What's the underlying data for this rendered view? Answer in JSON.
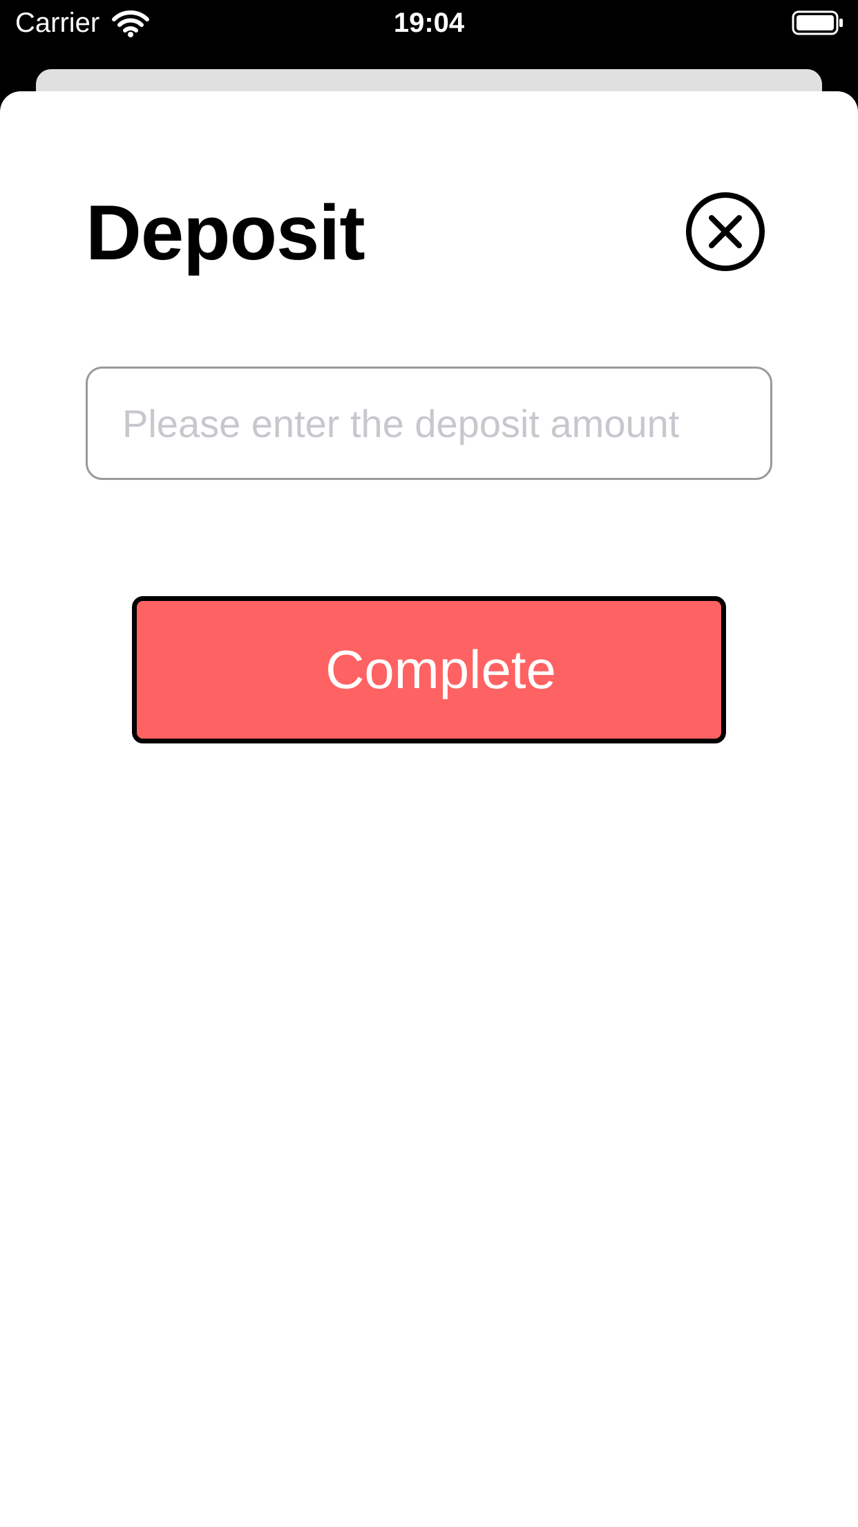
{
  "status_bar": {
    "carrier": "Carrier",
    "time": "19:04",
    "wifi_icon": "wifi-icon",
    "battery_icon": "battery-full-icon"
  },
  "sheet": {
    "title": "Deposit",
    "close_icon": "close-circle-icon",
    "amount_input": {
      "value": "",
      "placeholder": "Please enter the deposit amount"
    },
    "complete_button": {
      "label": "Complete"
    }
  },
  "colors": {
    "status_bar_background": "#000000",
    "sheet_background": "#ffffff",
    "back_card": "#e0e0e0",
    "button_fill": "#ff6262",
    "button_border": "#000000",
    "button_text": "#ffffff",
    "placeholder_text": "#c7c7cd",
    "input_border": "#9a9a9a"
  }
}
